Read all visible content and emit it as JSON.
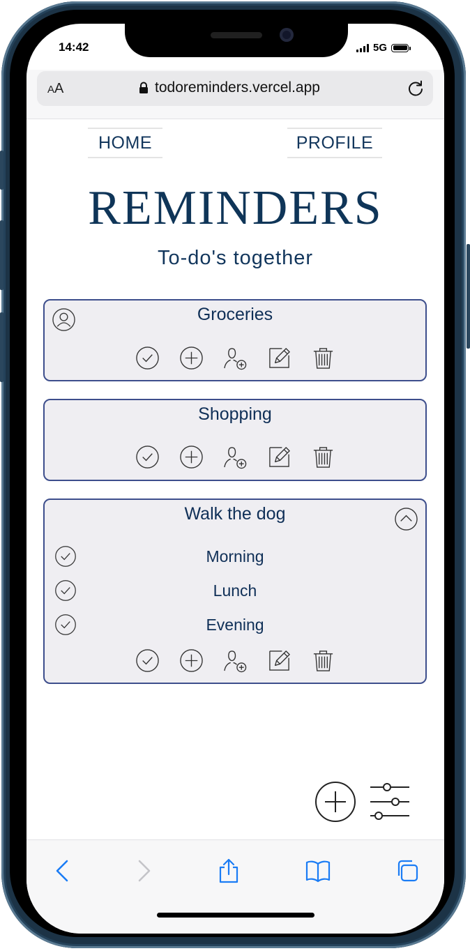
{
  "status_bar": {
    "time": "14:42",
    "network": "5G"
  },
  "browser": {
    "text_size_small": "A",
    "text_size_large": "A",
    "url": "todoreminders.vercel.app"
  },
  "nav": {
    "home": "HOME",
    "profile": "PROFILE"
  },
  "app": {
    "title": "REMINDERS",
    "subtitle": "To-do's together"
  },
  "lists": [
    {
      "title": "Groceries"
    },
    {
      "title": "Shopping"
    },
    {
      "title": "Walk the dog",
      "items": [
        "Morning",
        "Lunch",
        "Evening"
      ]
    }
  ],
  "icons": {
    "owner": "user-circle-icon",
    "complete": "check-circle-icon",
    "add": "plus-circle-icon",
    "share": "add-user-icon",
    "edit": "edit-icon",
    "delete": "trash-icon",
    "collapse": "chevron-up-icon",
    "filter": "sliders-icon"
  },
  "colors": {
    "primary": "#0f3558",
    "card_bg": "#efeef2",
    "card_border": "#3d4e8c",
    "ios_blue": "#1a7cf5"
  }
}
